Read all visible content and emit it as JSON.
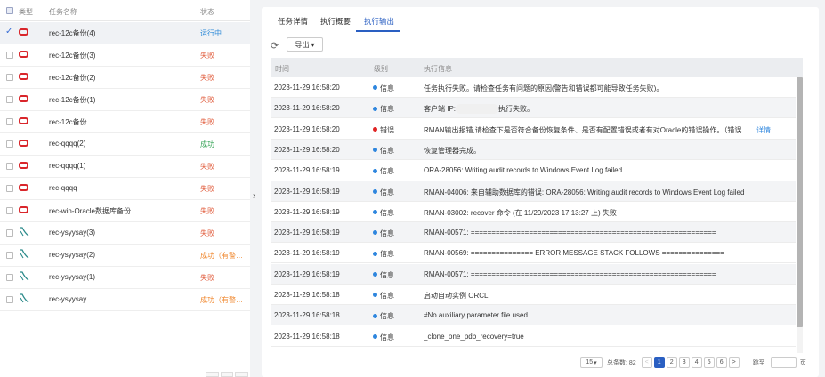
{
  "left": {
    "headers": {
      "type": "类型",
      "name": "任务名称",
      "status": "状态"
    },
    "tasks": [
      {
        "name": "rec-12c备份(4)",
        "status": "运行中",
        "cls": "running",
        "icon": "oracle-db-icon",
        "selected": true
      },
      {
        "name": "rec-12c备份(3)",
        "status": "失败",
        "cls": "fail",
        "icon": "oracle-db-icon"
      },
      {
        "name": "rec-12c备份(2)",
        "status": "失败",
        "cls": "fail",
        "icon": "oracle-db-icon"
      },
      {
        "name": "rec-12c备份(1)",
        "status": "失败",
        "cls": "fail",
        "icon": "oracle-db-icon"
      },
      {
        "name": "rec-12c备份",
        "status": "失败",
        "cls": "fail",
        "icon": "oracle-db-icon"
      },
      {
        "name": "rec-qqqq(2)",
        "status": "成功",
        "cls": "ok",
        "icon": "oracle-db-icon"
      },
      {
        "name": "rec-qqqq(1)",
        "status": "失败",
        "cls": "fail",
        "icon": "oracle-db-icon"
      },
      {
        "name": "rec-qqqq",
        "status": "失败",
        "cls": "fail",
        "icon": "oracle-db-icon"
      },
      {
        "name": "rec-win-Oracle数据库备份",
        "status": "失败",
        "cls": "fail",
        "icon": "oracle-db-icon"
      },
      {
        "name": "rec-ysyysay(3)",
        "status": "失败",
        "cls": "fail",
        "icon": "sql-server-icon"
      },
      {
        "name": "rec-ysyysay(2)",
        "status": "成功（有警…",
        "cls": "warn",
        "icon": "sql-server-icon"
      },
      {
        "name": "rec-ysyysay(1)",
        "status": "失败",
        "cls": "fail",
        "icon": "sql-server-icon"
      },
      {
        "name": "rec-ysyysay",
        "status": "成功（有警…",
        "cls": "warn",
        "icon": "sql-server-icon"
      }
    ]
  },
  "tabs": [
    {
      "label": "任务详情",
      "active": false
    },
    {
      "label": "执行概要",
      "active": false
    },
    {
      "label": "执行输出",
      "active": true
    }
  ],
  "toolbar": {
    "refresh_icon": "refresh-icon",
    "export_label": "导出"
  },
  "log_table": {
    "headers": {
      "time": "时间",
      "level": "级别",
      "message": "执行信息"
    },
    "rows": [
      {
        "time": "2023-11-29 16:58:20",
        "level": "信息",
        "type": "info",
        "message": "任务执行失败。请检查任务有问题的原因(警告和错误都可能导致任务失败)。"
      },
      {
        "time": "2023-11-29 16:58:20",
        "level": "信息",
        "type": "info",
        "message": "客户端 IP:",
        "message_suffix": "执行失败。",
        "masked": true
      },
      {
        "time": "2023-11-29 16:58:20",
        "level": "错误",
        "type": "err",
        "message": "RMAN输出报错,请检查下是否符合备份恢复条件、是否有配置错误或者有对Oracle的错误操作。（错误…",
        "detail": "详情"
      },
      {
        "time": "2023-11-29 16:58:20",
        "level": "信息",
        "type": "info",
        "message": "恢复管理器完成。"
      },
      {
        "time": "2023-11-29 16:58:19",
        "level": "信息",
        "type": "info",
        "message": "ORA-28056: Writing audit records to Windows Event Log failed"
      },
      {
        "time": "2023-11-29 16:58:19",
        "level": "信息",
        "type": "info",
        "message": "RMAN-04006: 来自辅助数据库的错误: ORA-28056: Writing audit records to Windows Event Log failed"
      },
      {
        "time": "2023-11-29 16:58:19",
        "level": "信息",
        "type": "info",
        "message": "RMAN-03002: recover 命令 (在 11/29/2023 17:13:27 上) 失败"
      },
      {
        "time": "2023-11-29 16:58:19",
        "level": "信息",
        "type": "info",
        "message": "RMAN-00571: ==========================================================="
      },
      {
        "time": "2023-11-29 16:58:19",
        "level": "信息",
        "type": "info",
        "message": "RMAN-00569: =============== ERROR MESSAGE STACK FOLLOWS ==============="
      },
      {
        "time": "2023-11-29 16:58:19",
        "level": "信息",
        "type": "info",
        "message": "RMAN-00571: ==========================================================="
      },
      {
        "time": "2023-11-29 16:58:18",
        "level": "信息",
        "type": "info",
        "message": "启动自动实例 ORCL"
      },
      {
        "time": "2023-11-29 16:58:18",
        "level": "信息",
        "type": "info",
        "message": "#No auxiliary parameter file used"
      },
      {
        "time": "2023-11-29 16:58:18",
        "level": "信息",
        "type": "info",
        "message": "_clone_one_pdb_recovery=true"
      }
    ]
  },
  "pagination": {
    "page_size": "15",
    "total_label": "总条数: 82",
    "prev": "<",
    "pages": [
      "1",
      "2",
      "3",
      "4",
      "5",
      "6"
    ],
    "current": "1",
    "next": ">",
    "goto_label": "跳至",
    "goto_suffix": "页"
  },
  "splitter_arrow": "›"
}
